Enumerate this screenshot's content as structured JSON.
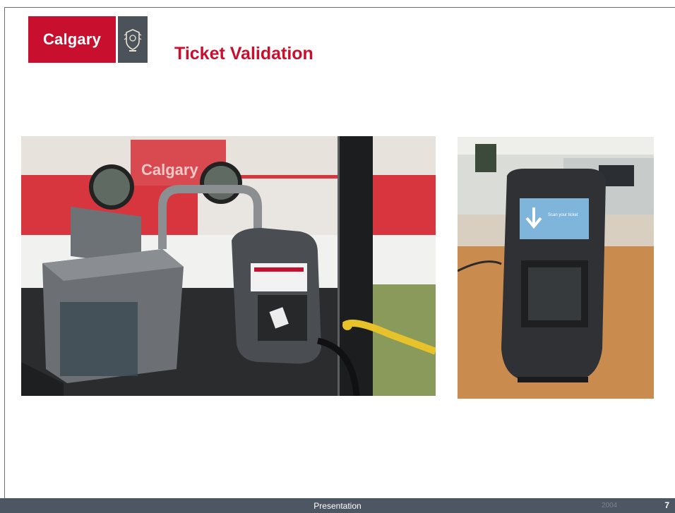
{
  "brand": {
    "wordmark": "Calgary"
  },
  "slide": {
    "title": "Ticket Validation"
  },
  "images": {
    "left": {
      "sign_text": "Calgary"
    },
    "right": {
      "screen_text": "Scan your ticket"
    }
  },
  "footer": {
    "label": "Presentation",
    "code": "2004",
    "page": "7"
  },
  "colors": {
    "brand_red": "#c8102e",
    "footer_bg": "#4d5763",
    "crest_bg": "#4b525a"
  }
}
